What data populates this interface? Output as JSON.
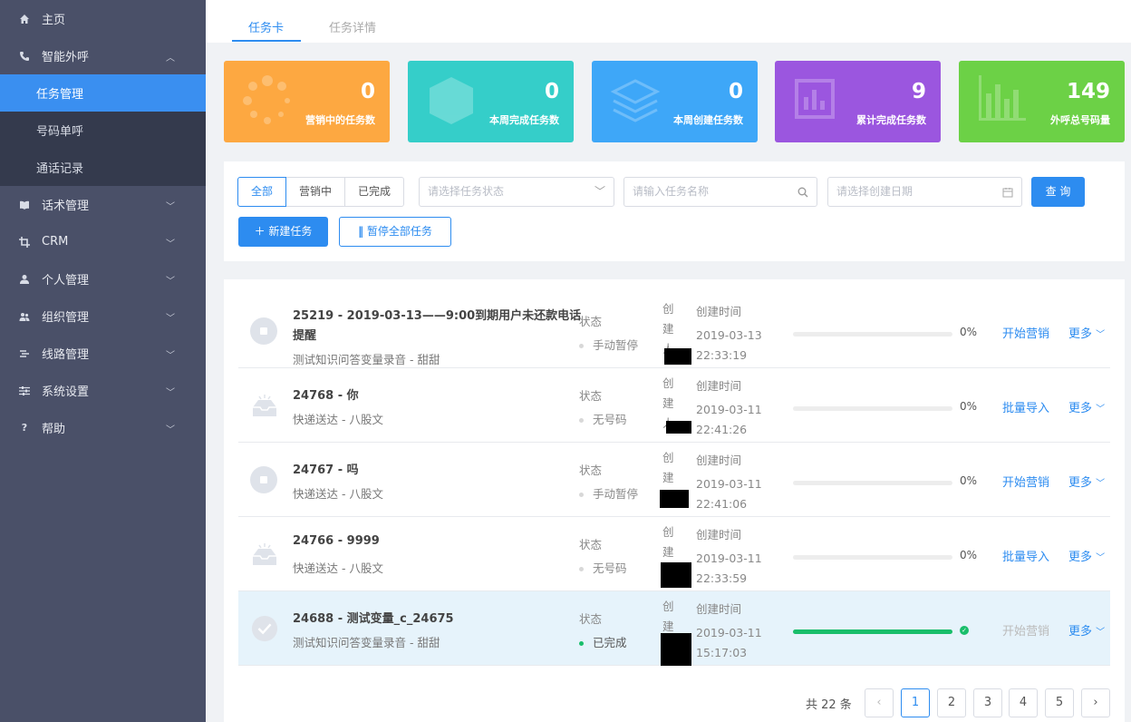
{
  "sidebar": {
    "items": [
      {
        "label": "主页",
        "icon": "home-icon"
      },
      {
        "label": "智能外呼",
        "icon": "phone-icon",
        "expanded": true,
        "children": [
          {
            "label": "任务管理",
            "active": true
          },
          {
            "label": "号码单呼"
          },
          {
            "label": "通话记录"
          }
        ]
      },
      {
        "label": "话术管理",
        "icon": "book-icon"
      },
      {
        "label": "CRM",
        "icon": "crop-icon"
      },
      {
        "label": "个人管理",
        "icon": "user-icon"
      },
      {
        "label": "组织管理",
        "icon": "team-icon"
      },
      {
        "label": "线路管理",
        "icon": "route-icon"
      },
      {
        "label": "系统设置",
        "icon": "sliders-icon"
      },
      {
        "label": "帮助",
        "icon": "help-icon"
      }
    ]
  },
  "tabs": [
    {
      "label": "任务卡",
      "active": true
    },
    {
      "label": "任务详情"
    }
  ],
  "stats": [
    {
      "value": "0",
      "label": "营销中的任务数",
      "color": "#fda841"
    },
    {
      "value": "0",
      "label": "本周完成任务数",
      "color": "#35cec9"
    },
    {
      "value": "0",
      "label": "本周创建任务数",
      "color": "#3ea7f8"
    },
    {
      "value": "9",
      "label": "累计完成任务数",
      "color": "#9b56df"
    },
    {
      "value": "149",
      "label": "外呼总号码量",
      "color": "#6cd146"
    }
  ],
  "filters": {
    "segments": [
      "全部",
      "营销中",
      "已完成"
    ],
    "status_placeholder": "请选择任务状态",
    "name_placeholder": "请输入任务名称",
    "date_placeholder": "请选择创建日期",
    "query_label": "查 询",
    "new_task_label": "新建任务",
    "pause_all_label": "暂停全部任务"
  },
  "tasks": [
    {
      "title": "25219 - 2019-03-13——9:00到期用户未还款电话提醒",
      "subtitle": "测试知识问答变量录音 - 甜甜",
      "icon": "stop-icon",
      "status_label": "状态",
      "status": "手动暂停",
      "creator_label": "创建人",
      "created_label": "创建时间",
      "date": "2019-03-13",
      "time": "22:33:19",
      "progress": 0,
      "progress_text": "0%",
      "action": "开始营销",
      "more": "更多"
    },
    {
      "title": "24768 - 你",
      "subtitle": "快递送达 - 八股文",
      "icon": "inbox-icon",
      "status_label": "状态",
      "status": "无号码",
      "creator_label": "创建人",
      "created_label": "创建时间",
      "date": "2019-03-11",
      "time": "22:41:26",
      "progress": 0,
      "progress_text": "0%",
      "action": "批量导入",
      "more": "更多"
    },
    {
      "title": "24767 - 吗",
      "subtitle": "快递送达 - 八股文",
      "icon": "stop-icon",
      "status_label": "状态",
      "status": "手动暂停",
      "creator_label": "创建人",
      "created_label": "创建时间",
      "date": "2019-03-11",
      "time": "22:41:06",
      "progress": 0,
      "progress_text": "0%",
      "action": "开始营销",
      "more": "更多"
    },
    {
      "title": "24766 - 9999",
      "subtitle": "快递送达 - 八股文",
      "icon": "inbox-icon",
      "status_label": "状态",
      "status": "无号码",
      "creator_label": "创建人",
      "created_label": "创建时间",
      "date": "2019-03-11",
      "time": "22:33:59",
      "progress": 0,
      "progress_text": "0%",
      "action": "批量导入",
      "more": "更多"
    },
    {
      "title": "24688 - 测试变量_c_24675",
      "subtitle": "测试知识问答变量录音 - 甜甜",
      "icon": "check-icon",
      "status_label": "状态",
      "status": "已完成",
      "creator_label": "创建人",
      "created_label": "创建时间",
      "date": "2019-03-11",
      "time": "15:17:03",
      "progress": 100,
      "progress_text": "",
      "action": "开始营销",
      "more": "更多"
    }
  ],
  "pagination": {
    "total_text": "共 22 条",
    "pages": [
      "1",
      "2",
      "3",
      "4",
      "5"
    ],
    "current": "1"
  }
}
